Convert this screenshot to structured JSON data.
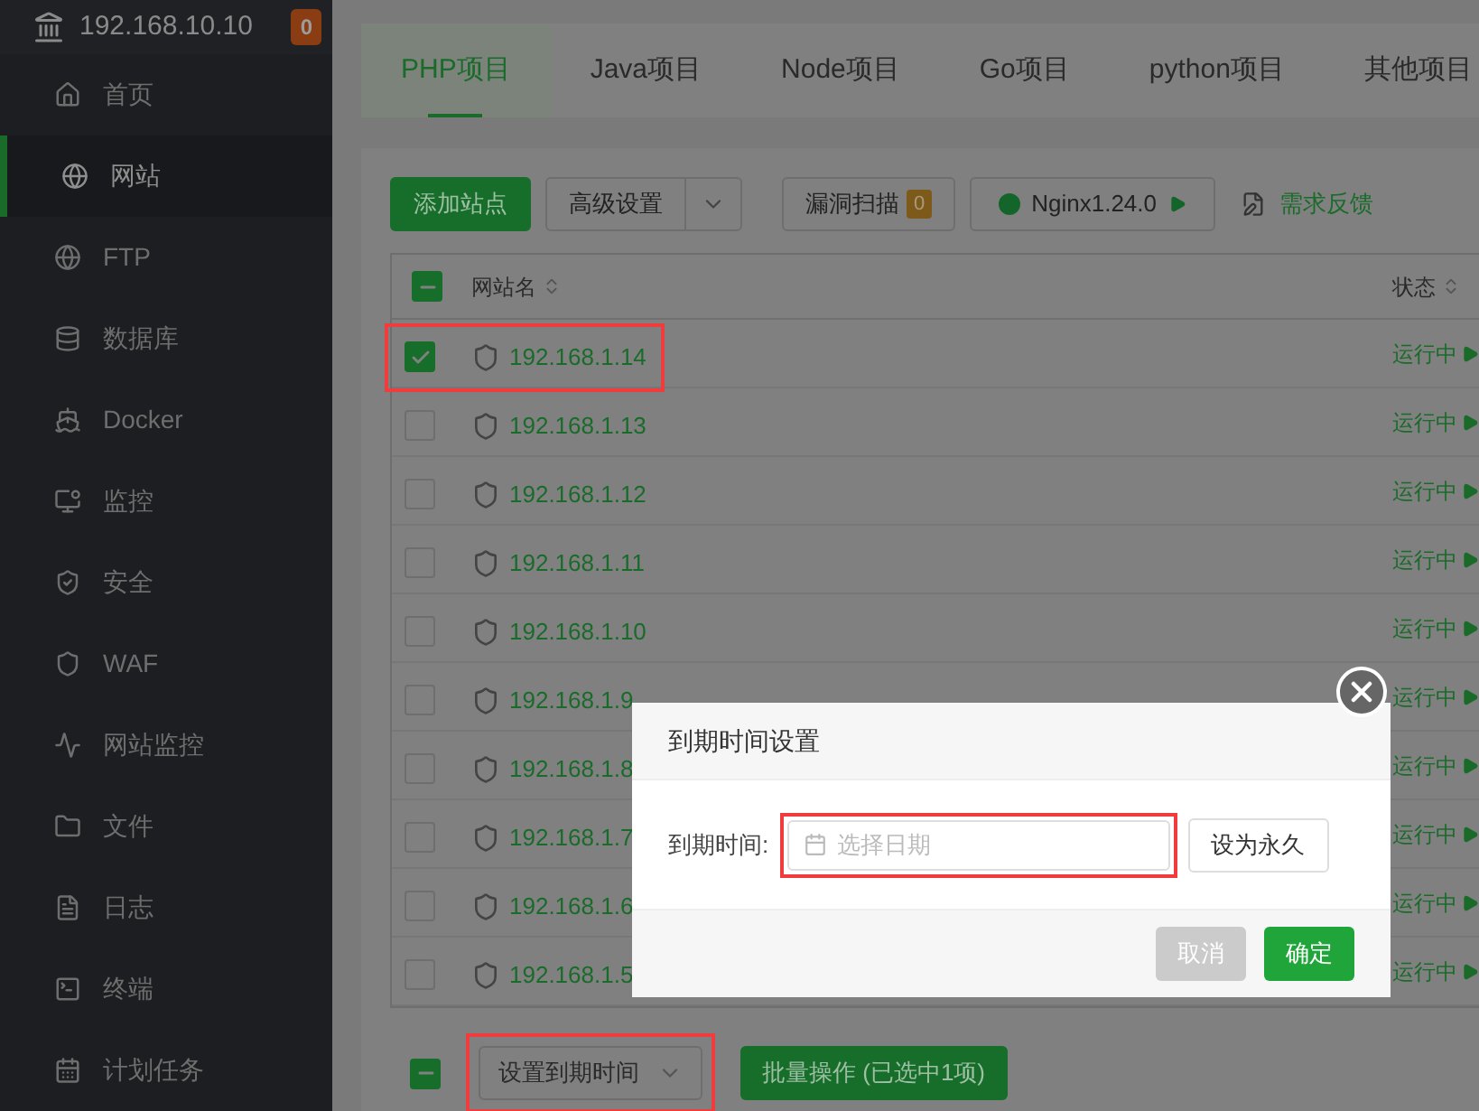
{
  "sidebar": {
    "host": "192.168.10.10",
    "badge": "0",
    "items": [
      {
        "label": "首页",
        "selected": false
      },
      {
        "label": "网站",
        "selected": true
      },
      {
        "label": "FTP",
        "selected": false
      },
      {
        "label": "数据库",
        "selected": false
      },
      {
        "label": "Docker",
        "selected": false
      },
      {
        "label": "监控",
        "selected": false
      },
      {
        "label": "安全",
        "selected": false
      },
      {
        "label": "WAF",
        "selected": false
      },
      {
        "label": "网站监控",
        "selected": false
      },
      {
        "label": "文件",
        "selected": false
      },
      {
        "label": "日志",
        "selected": false
      },
      {
        "label": "终端",
        "selected": false
      },
      {
        "label": "计划任务",
        "selected": false
      }
    ]
  },
  "tabs": [
    {
      "label": "PHP项目",
      "selected": true
    },
    {
      "label": "Java项目",
      "selected": false
    },
    {
      "label": "Node项目",
      "selected": false
    },
    {
      "label": "Go项目",
      "selected": false
    },
    {
      "label": "python项目",
      "selected": false
    },
    {
      "label": "其他项目",
      "selected": false
    }
  ],
  "toolbar": {
    "add_site": "添加站点",
    "advanced": "高级设置",
    "scan": "漏洞扫描",
    "scan_count": "0",
    "nginx": "Nginx1.24.0",
    "feedback": "需求反馈"
  },
  "table": {
    "columns": [
      "网站名",
      "状态"
    ],
    "select_all_partial": true,
    "rows": [
      {
        "name": "192.168.1.14",
        "status": "运行中",
        "checked": true,
        "highlighted": true
      },
      {
        "name": "192.168.1.13",
        "status": "运行中",
        "checked": false,
        "highlighted": false
      },
      {
        "name": "192.168.1.12",
        "status": "运行中",
        "checked": false,
        "highlighted": false
      },
      {
        "name": "192.168.1.11",
        "status": "运行中",
        "checked": false,
        "highlighted": false
      },
      {
        "name": "192.168.1.10",
        "status": "运行中",
        "checked": false,
        "highlighted": false
      },
      {
        "name": "192.168.1.9",
        "status": "运行中",
        "checked": false,
        "highlighted": false
      },
      {
        "name": "192.168.1.8",
        "status": "运行中",
        "checked": false,
        "highlighted": false
      },
      {
        "name": "192.168.1.7",
        "status": "运行中",
        "checked": false,
        "highlighted": false
      },
      {
        "name": "192.168.1.6",
        "status": "运行中",
        "checked": false,
        "highlighted": false
      },
      {
        "name": "192.168.1.5",
        "status": "运行中",
        "checked": false,
        "highlighted": false
      }
    ]
  },
  "bulk": {
    "select_partial": true,
    "action": "设置到期时间",
    "highlighted": true,
    "button": "批量操作 (已选中1项)"
  },
  "dialog": {
    "title": "到期时间设置",
    "label": "到期时间:",
    "placeholder": "选择日期",
    "highlighted": true,
    "forever": "设为永久",
    "cancel": "取消",
    "confirm": "确定"
  }
}
